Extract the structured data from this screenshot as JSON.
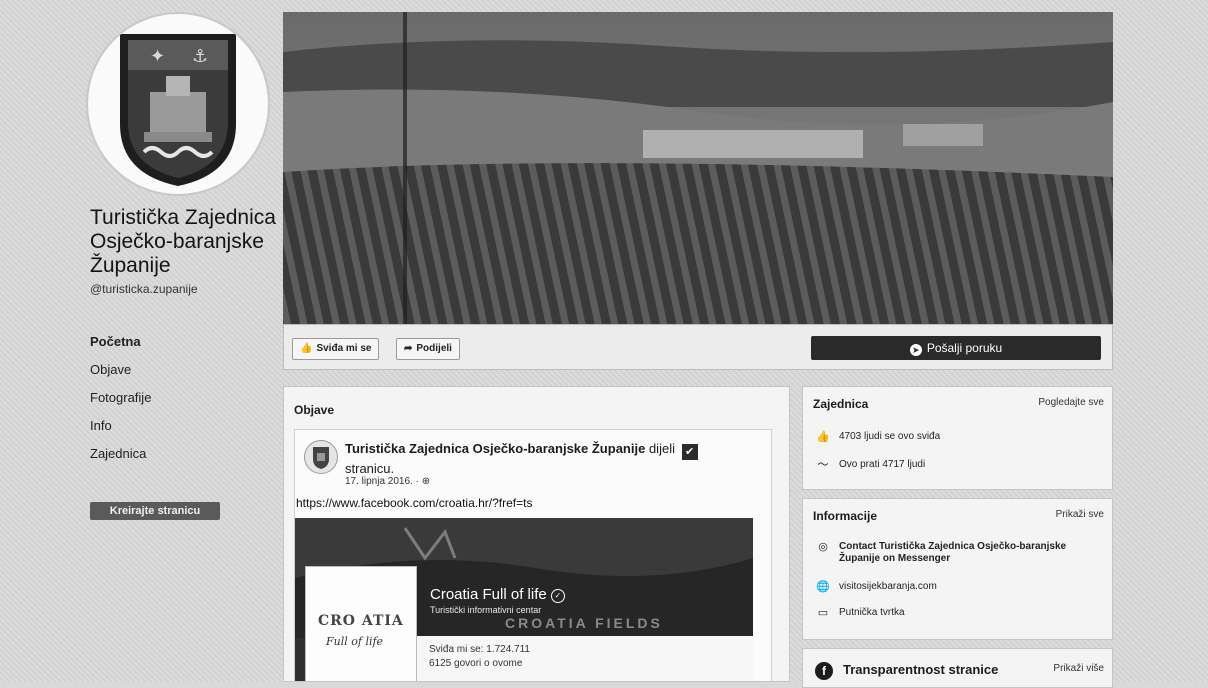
{
  "page": {
    "name": "Turistička Zajednica Osječko-baranjske Županije",
    "handle": "@turisticka.zupanije"
  },
  "left_nav": {
    "items": [
      {
        "label": "Početna",
        "active": true
      },
      {
        "label": "Objave",
        "active": false
      },
      {
        "label": "Fotografije",
        "active": false
      },
      {
        "label": "Info",
        "active": false
      },
      {
        "label": "Zajednica",
        "active": false
      }
    ],
    "create_page_label": "Kreirajte stranicu"
  },
  "action_bar": {
    "like_label": "Sviđa mi se",
    "like_icon": "thumbs-up-icon",
    "share_label": "Podijeli",
    "share_icon": "share-arrow-icon",
    "message_label": "Pošalji poruku",
    "message_icon": "messenger-icon"
  },
  "posts": {
    "title": "Objave",
    "post": {
      "author": "Turistička Zajednica Osječko-baranjske Županije",
      "action": "dijeli",
      "object": "stranicu.",
      "date": "17. lipnja 2016. ·",
      "link": "https://www.facebook.com/croatia.hr/?fref=ts",
      "embed": {
        "logo_line1": "CRO ATIA",
        "logo_line2": "Full of life",
        "name": "Croatia Full of life",
        "subtitle": "Turistički informativni centar",
        "watermark": "CROATIA FIELDS",
        "likes": "Sviđa mi se: 1.724.711",
        "talking": "6125 govori o ovome"
      }
    }
  },
  "community": {
    "title": "Zajednica",
    "see_all": "Pogledajte sve",
    "likes": "4703 ljudi se ovo sviđa",
    "follows": "Ovo prati 4717 ljudi"
  },
  "about": {
    "title": "Informacije",
    "see_all": "Prikaži sve",
    "messenger": "Contact Turistička Zajednica Osječko-baranjske Županije on Messenger",
    "website": "visitosijekbaranja.com",
    "category": "Putnička tvrtka"
  },
  "transparency": {
    "title": "Transparentnost stranice",
    "see_more": "Prikaži više"
  },
  "colors": {
    "dark_button": "#2a2a2a",
    "page_bg": "#d9d9d9",
    "card_bg": "#f4f4f4"
  }
}
